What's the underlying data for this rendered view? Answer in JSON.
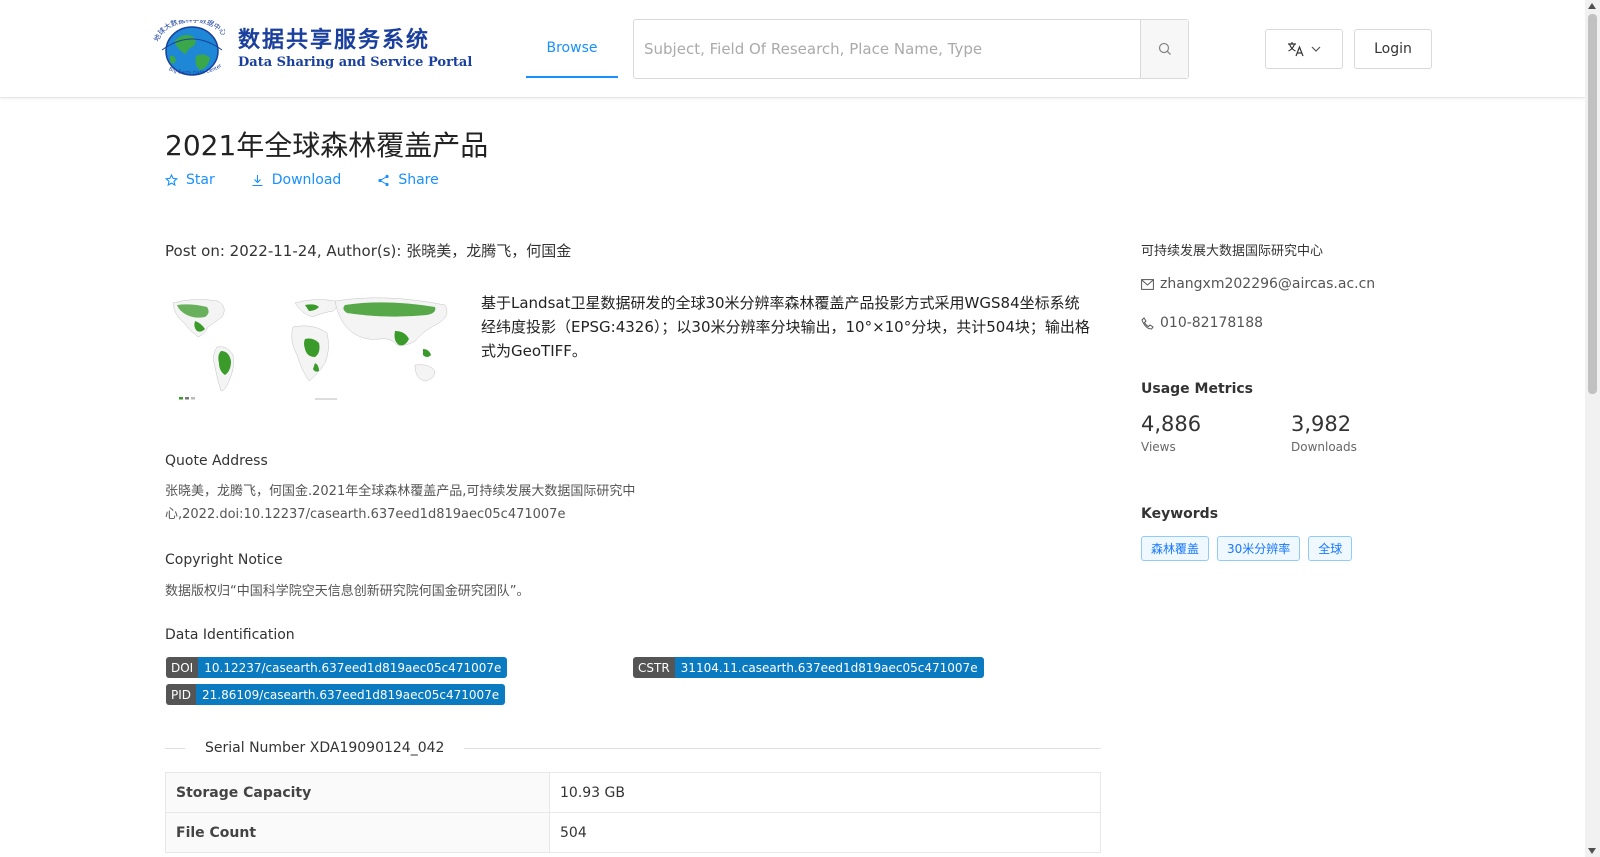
{
  "header": {
    "logo_cn": "数据共享服务系统",
    "logo_en": "Data Sharing and Service Portal",
    "logo_ring_text": "地球大数据科学数据中心",
    "logo_ring_text_en": "Big Earth Data Center, CAS",
    "nav_browse": "Browse",
    "search_placeholder": "Subject, Field Of Research, Place Name, Type",
    "login": "Login"
  },
  "dataset": {
    "title": "2021年全球森林覆盖产品",
    "actions": {
      "star": "Star",
      "download": "Download",
      "share": "Share"
    },
    "post_on": "Post on: 2022-11-24, Author(s): 张晓美，龙腾飞，何国金",
    "description": "基于Landsat卫星数据研发的全球30米分辨率森林覆盖产品投影方式采用WGS84坐标系统经纬度投影（EPSG:4326）；以30米分辨率分块输出，10°×10°分块，共计504块；输出格式为GeoTIFF。",
    "quote_heading": "Quote Address",
    "quote_text": "张晓美，龙腾飞，何国金.2021年全球森林覆盖产品,可持续发展大数据国际研究中心,2022.doi:10.12237/casearth.637eed1d819aec05c471007e",
    "copyright_heading": "Copyright Notice",
    "copyright_text": "数据版权归“中国科学院空天信息创新研究院何国金研究团队”。",
    "identification_heading": "Data Identification",
    "ids": {
      "doi_label": "DOI",
      "doi_value": "10.12237/casearth.637eed1d819aec05c471007e",
      "cstr_label": "CSTR",
      "cstr_value": "31104.11.casearth.637eed1d819aec05c471007e",
      "pid_label": "PID",
      "pid_value": "21.86109/casearth.637eed1d819aec05c471007e"
    },
    "serial": "Serial Number XDA19090124_042",
    "table": [
      {
        "key": "Storage Capacity",
        "value": "10.93 GB"
      },
      {
        "key": "File Count",
        "value": "504"
      }
    ]
  },
  "sidebar": {
    "org": "可持续发展大数据国际研究中心",
    "email": "zhangxm202296@aircas.ac.cn",
    "phone": "010-82178188",
    "usage_heading": "Usage Metrics",
    "views_value": "4,886",
    "views_label": "Views",
    "downloads_value": "3,982",
    "downloads_label": "Downloads",
    "keywords_heading": "Keywords",
    "keywords": [
      "森林覆盖",
      "30米分辨率",
      "全球"
    ]
  },
  "colors": {
    "accent": "#1890ff",
    "logo_blue": "#1a3f9c",
    "id_value_bg": "#0a7bc1",
    "forest_green": "#3a9a2a"
  }
}
